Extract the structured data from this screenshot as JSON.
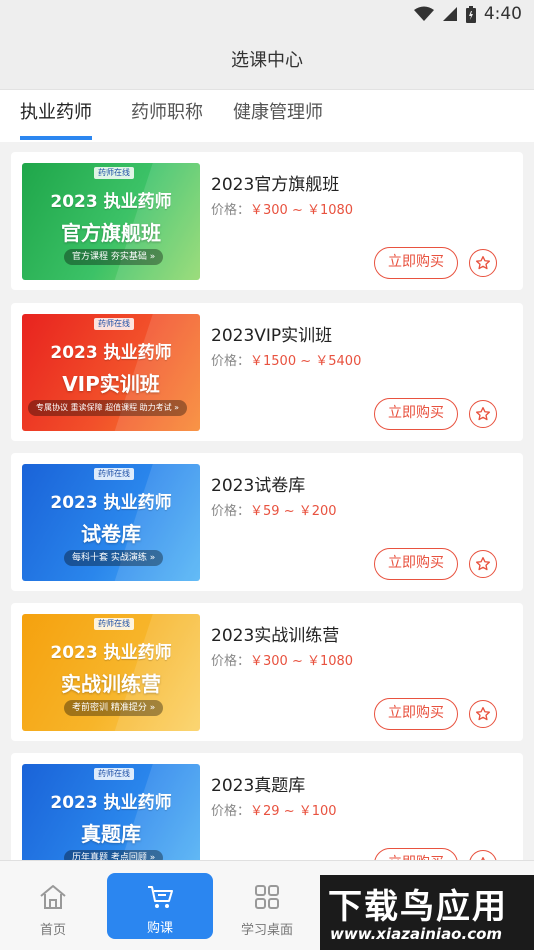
{
  "status": {
    "time": "4:40"
  },
  "header": {
    "title": "选课中心"
  },
  "tabs": [
    {
      "label": "执业药师",
      "active": true
    },
    {
      "label": "药师职称",
      "active": false
    },
    {
      "label": "健康管理师",
      "active": false
    }
  ],
  "courses": [
    {
      "title": "2023官方旗舰班",
      "price_label": "价格：",
      "price": "￥300 ~ ￥1080",
      "buy_label": "立即购买",
      "thumb": {
        "logo": "药师在线",
        "year": "2023 执业药师",
        "big": "官方旗舰班",
        "tagline": "官方课程 夯实基础 »"
      }
    },
    {
      "title": "2023VIP实训班",
      "price_label": "价格：",
      "price": "￥1500 ~ ￥5400",
      "buy_label": "立即购买",
      "thumb": {
        "logo": "药师在线",
        "year": "2023 执业药师",
        "big": "VIP实训班",
        "tagline": "专属协议 重读保障 超值课程 助力考试 »"
      }
    },
    {
      "title": "2023试卷库",
      "price_label": "价格：",
      "price": "￥59 ~ ￥200",
      "buy_label": "立即购买",
      "thumb": {
        "logo": "药师在线",
        "year": "2023 执业药师",
        "big": "试卷库",
        "tagline": "每科十套 实战演练 »"
      }
    },
    {
      "title": "2023实战训练营",
      "price_label": "价格：",
      "price": "￥300 ~ ￥1080",
      "buy_label": "立即购买",
      "thumb": {
        "logo": "药师在线",
        "year": "2023 执业药师",
        "big": "实战训练营",
        "tagline": "考前密训 精准提分 »"
      }
    },
    {
      "title": "2023真题库",
      "price_label": "价格：",
      "price": "￥29 ~ ￥100",
      "buy_label": "立即购买",
      "thumb": {
        "logo": "药师在线",
        "year": "2023 执业药师",
        "big": "真题库",
        "tagline": "历年真题 考点回顾 »"
      }
    }
  ],
  "nav": [
    {
      "label": "首页",
      "icon": "home-icon"
    },
    {
      "label": "购课",
      "icon": "cart-icon",
      "active": true
    },
    {
      "label": "学习桌面",
      "icon": "grid-icon"
    }
  ],
  "watermark": {
    "line1": "下载鸟应用",
    "line2": "www.xiazainiao.com"
  },
  "colors": {
    "accent": "#2b86f0",
    "price": "#e8523f"
  }
}
